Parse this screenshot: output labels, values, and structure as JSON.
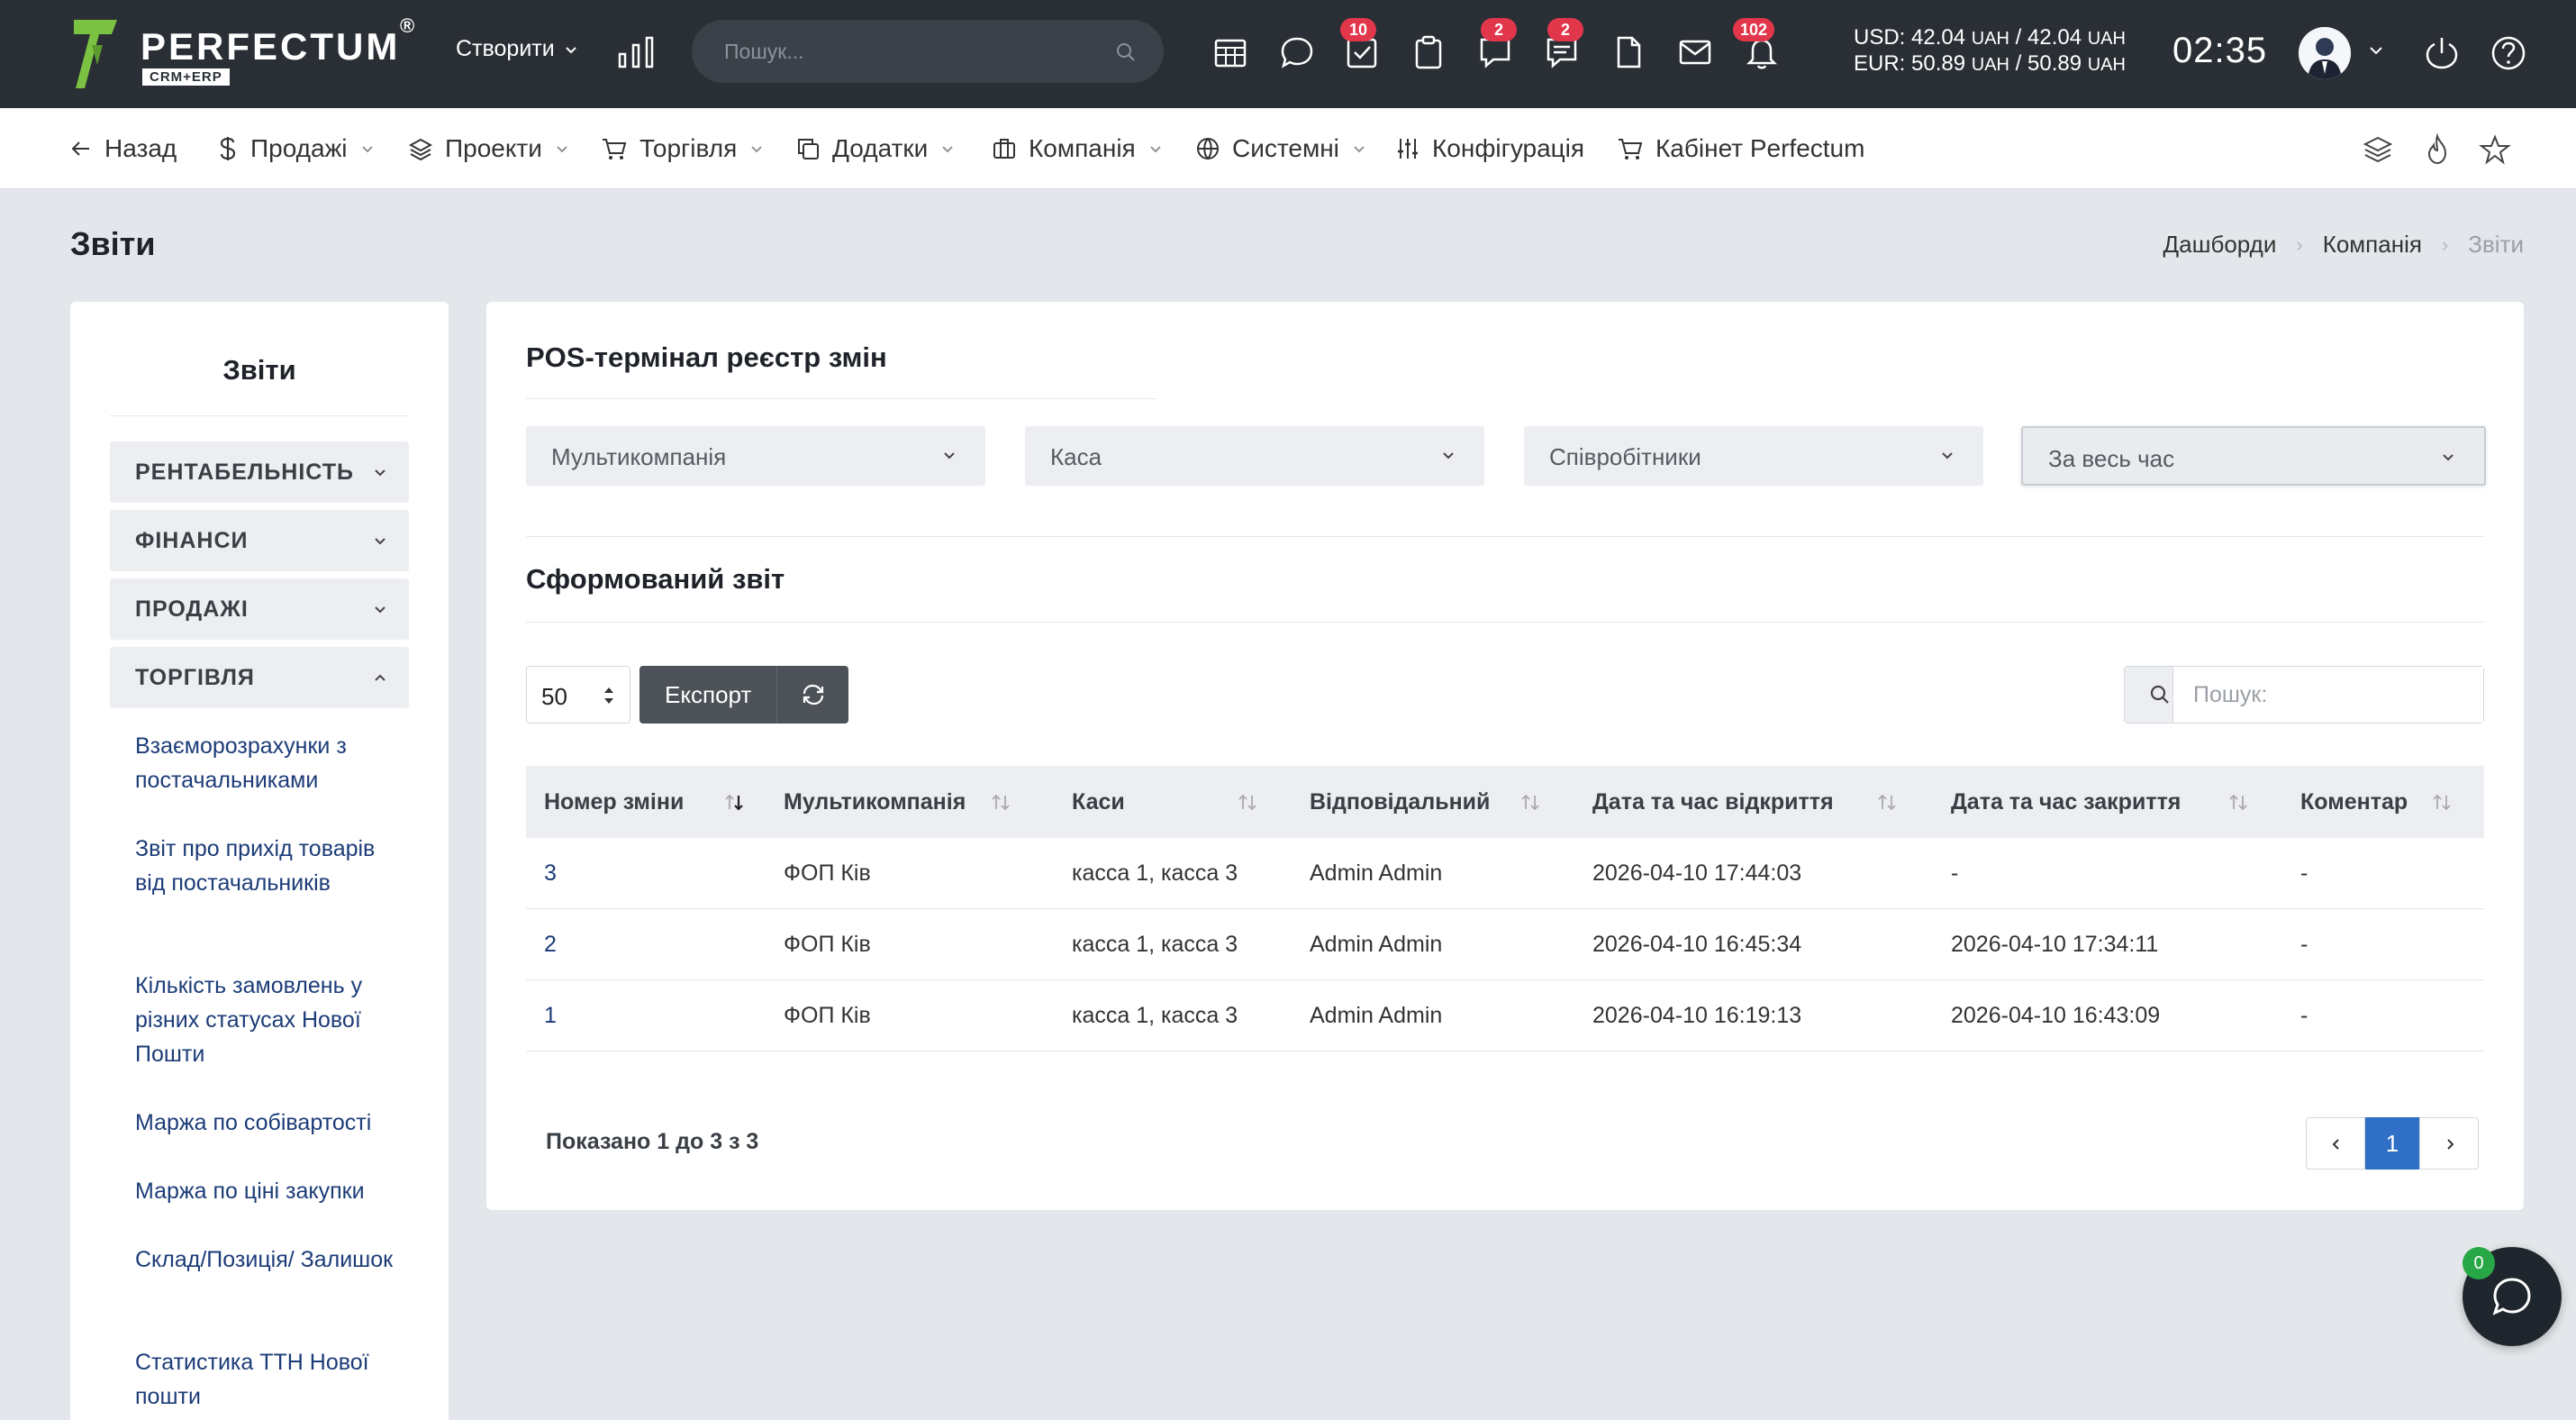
{
  "header": {
    "brand": "PERFECTUM",
    "brand_reg": "®",
    "brand_sub": "CRM+ERP",
    "create_label": "Створити",
    "search_placeholder": "Пошук...",
    "badges": {
      "tasks": "10",
      "chat": "2",
      "comments": "2",
      "notifications": "102"
    },
    "usd_label": "USD:",
    "usd_buy": "42.04",
    "usd_sell": "42.04",
    "eur_label": "EUR:",
    "eur_buy": "50.89",
    "eur_sell": "50.89",
    "currency_unit": "UAH",
    "time": "02:35"
  },
  "nav": {
    "items": [
      {
        "label": "Назад",
        "icon": "arrow-left-icon"
      },
      {
        "label": "Продажі",
        "icon": "dollar-icon"
      },
      {
        "label": "Проекти",
        "icon": "layers-icon"
      },
      {
        "label": "Торгівля",
        "icon": "cart-icon"
      },
      {
        "label": "Додатки",
        "icon": "copy-icon"
      },
      {
        "label": "Компанія",
        "icon": "briefcase-icon"
      },
      {
        "label": "Системні",
        "icon": "globe-icon"
      },
      {
        "label": "Конфігурація",
        "icon": "sliders-icon"
      },
      {
        "label": "Кабінет Perfectum",
        "icon": "cart-icon"
      }
    ]
  },
  "page": {
    "title": "Звіти",
    "breadcrumb": [
      "Дашборди",
      "Компанія",
      "Звіти"
    ]
  },
  "sidebar": {
    "title": "Звіти",
    "sections": [
      {
        "label": "РЕНТАБЕЛЬНІСТЬ",
        "expanded": false
      },
      {
        "label": "ФІНАНСИ",
        "expanded": false
      },
      {
        "label": "ПРОДАЖІ",
        "expanded": false
      },
      {
        "label": "ТОРГІВЛЯ",
        "expanded": true
      }
    ],
    "links": [
      "Взаєморозрахунки з постачальниками",
      "Звіт про прихід товарів від постачальників",
      "Кількість замовлень у різних статусах Нової Пошти",
      "Маржа по собівартості",
      "Маржа по ціні закупки",
      "Склад/Позиція/ Залишок",
      "Статистика ТТН Нової пошти"
    ]
  },
  "report": {
    "title": "POS-термінал реєстр змін",
    "filters": [
      "Мультикомпанія",
      "Каса",
      "Співробітники",
      "За весь час"
    ],
    "section_title": "Сформований звіт",
    "page_length": "50",
    "export_label": "Експорт",
    "search_placeholder": "Пошук:",
    "columns": [
      "Номер зміни",
      "Мультикомпанія",
      "Каси",
      "Відповідальний",
      "Дата та час відкриття",
      "Дата та час закриття",
      "Коментар"
    ],
    "rows": [
      [
        "3",
        "ФОП Ків",
        "касса 1, касса 3",
        "Admin Admin",
        "2026-04-10 17:44:03",
        "-",
        "-"
      ],
      [
        "2",
        "ФОП Ків",
        "касса 1, касса 3",
        "Admin Admin",
        "2026-04-10 16:45:34",
        "2026-04-10 17:34:11",
        "-"
      ],
      [
        "1",
        "ФОП Ків",
        "касса 1, касса 3",
        "Admin Admin",
        "2026-04-10 16:19:13",
        "2026-04-10 16:43:09",
        "-"
      ]
    ],
    "info": "Показано 1 до 3 з 3",
    "current_page": "1"
  },
  "chat": {
    "badge": "0"
  },
  "colors": {
    "topbar": "#2a2f35",
    "accent": "#2f6fc6",
    "badge": "#e2364b",
    "link": "#1c3c78",
    "logo_green": "#7cc242"
  }
}
